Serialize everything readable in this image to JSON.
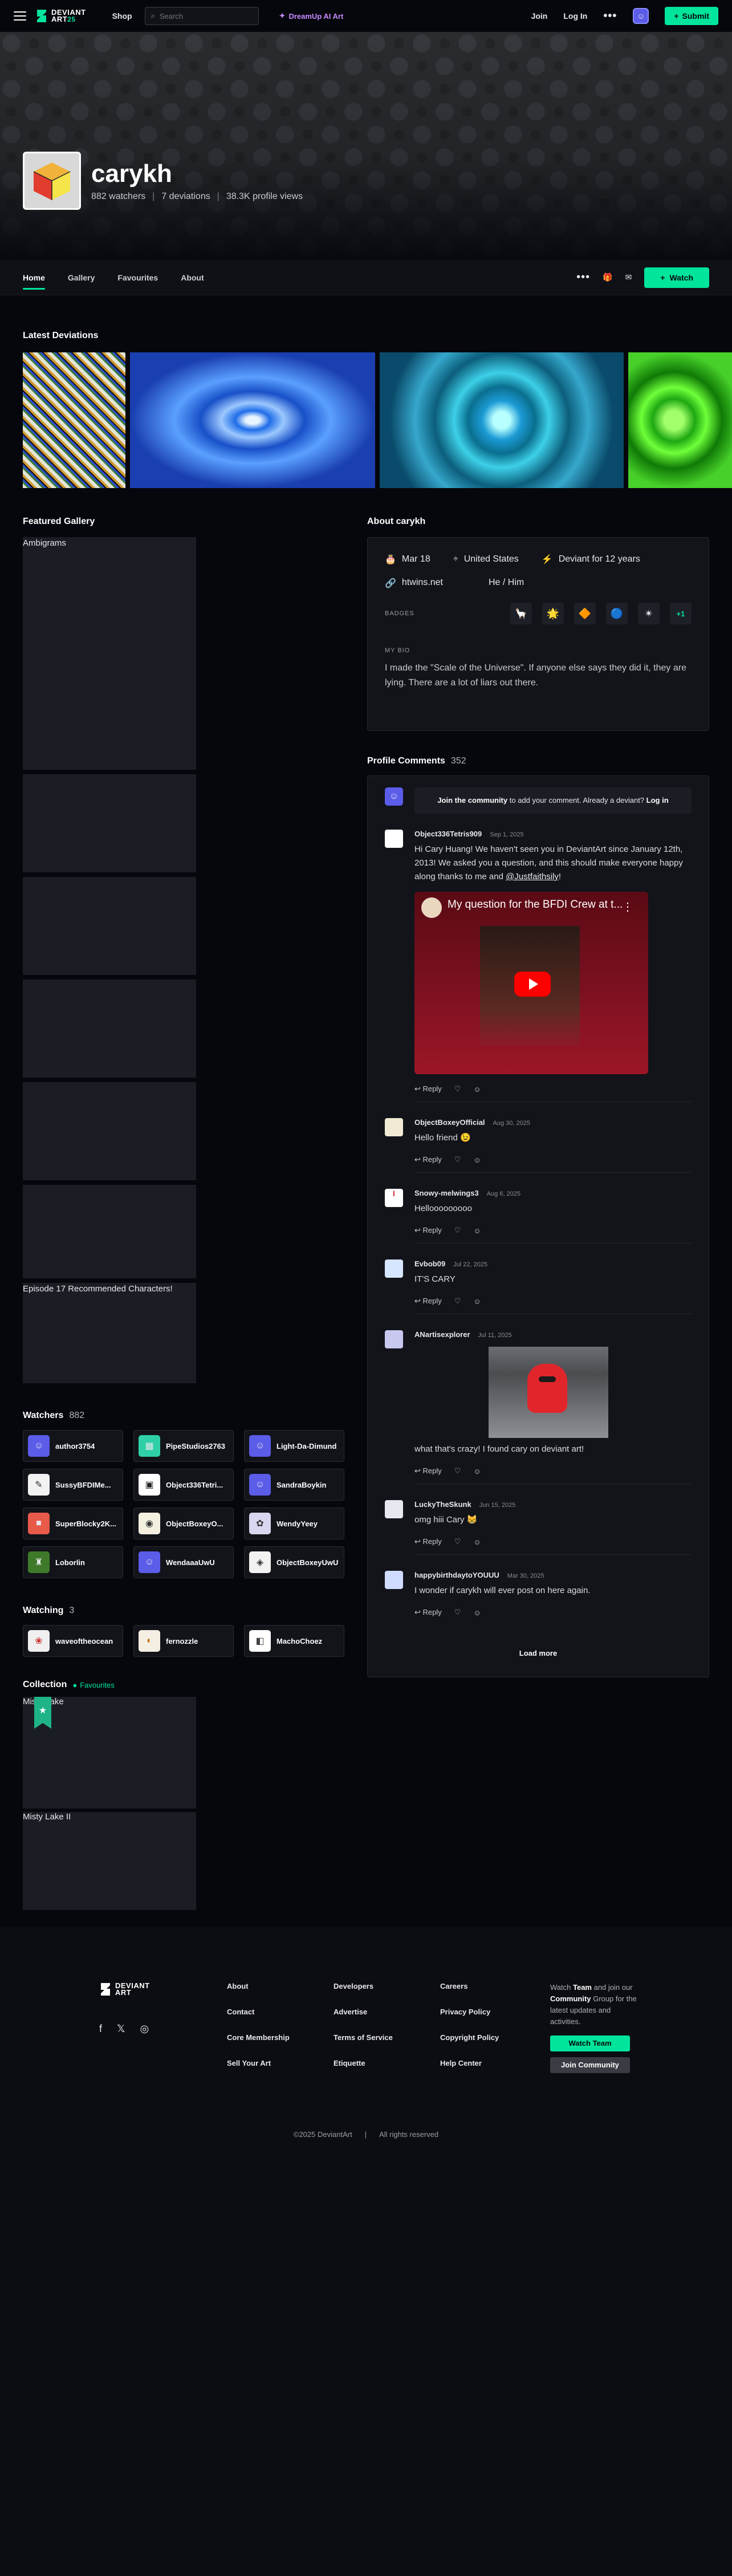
{
  "topbar": {
    "logo_line1": "DEVIANT",
    "logo_line2": "ART",
    "logo_years": "25",
    "shop": "Shop",
    "search_placeholder": "Search",
    "dreamup": "DreamUp AI Art",
    "join": "Join",
    "login": "Log In",
    "more": "•••",
    "submit": "Submit"
  },
  "profile": {
    "username": "carykh",
    "watchers": "882 watchers",
    "deviations": "7 deviations",
    "views": "38.3K profile views"
  },
  "tabs": {
    "items": [
      "Home",
      "Gallery",
      "Favourites",
      "About"
    ],
    "watch": "Watch"
  },
  "latest": {
    "title": "Latest Deviations"
  },
  "featured": {
    "title": "Featured Gallery",
    "items": [
      "Ambigrams",
      "",
      "",
      "",
      "",
      "",
      "Episode 17 Recommended Characters!"
    ]
  },
  "about": {
    "title": "About carykh",
    "birthday": "Mar 18",
    "country": "United States",
    "deviant_for": "Deviant for 12 years",
    "website": "htwins.net",
    "pronouns": "He / Him",
    "badges_label": "BADGES",
    "badges_more": "+1",
    "bio_label": "MY BIO",
    "bio": "I made the \"Scale of the Universe\".  If anyone else says they did it, they are lying.  There are a lot of liars out there."
  },
  "comments": {
    "title": "Profile Comments",
    "count": "352",
    "join_prefix": "Join the community",
    "join_middle": " to add your comment. Already a deviant? ",
    "join_login": "Log in",
    "reply": "Reply",
    "items": [
      {
        "name": "Object336Tetris909",
        "date": "Sep 1, 2025",
        "text": "Hi Cary Huang! We haven't seen you in DeviantArt since January 12th, 2013! We asked you a question, and this should make everyone happy along thanks to me and",
        "link": "@Justfaithsily",
        "tail": "!"
      },
      {
        "name": "ObjectBoxeyOfficial",
        "date": "Aug 30, 2025",
        "text": "Hello friend 😉"
      },
      {
        "name": "Snowy-melwings3",
        "date": "Aug 6, 2025",
        "text": "Hellooooooooo"
      },
      {
        "name": "Evbob09",
        "date": "Jul 22, 2025",
        "text": "IT'S CARY"
      },
      {
        "name": "ANartisexplorer",
        "date": "Jul 11, 2025",
        "text": "what that's crazy! I found cary on deviant art!"
      },
      {
        "name": "LuckyTheSkunk",
        "date": "Jun 15, 2025",
        "text": "omg hiii Cary 😸"
      },
      {
        "name": "happybirthdaytoYOUUU",
        "date": "Mar 30, 2025",
        "text": "I wonder if carykh will ever post on here again."
      }
    ],
    "video_title": "My question for the BFDI Crew at t...",
    "load_more": "Load more"
  },
  "watchers": {
    "title": "Watchers",
    "count": "882",
    "users": [
      "author3754",
      "PipeStudios2763",
      "Light-Da-Dimund",
      "SussyBFDIMe...",
      "Object336Tetri...",
      "SandraBoykin",
      "SuperBlocky2K...",
      "ObjectBoxeyO...",
      "WendyYeey",
      "Loborlin",
      "WendaaaUwU",
      "ObjectBoxeyUwU"
    ]
  },
  "watching": {
    "title": "Watching",
    "count": "3",
    "users": [
      "waveoftheocean",
      "fernozzle",
      "MachoChoez"
    ]
  },
  "collection": {
    "title": "Collection",
    "fav_label": "Favourites",
    "items": [
      "Misty Lake",
      "Misty Lake II"
    ]
  },
  "footer": {
    "col1": [
      "About",
      "Contact",
      "Core Membership",
      "Sell Your Art"
    ],
    "col2": [
      "Developers",
      "Advertise",
      "Terms of Service",
      "Etiquette"
    ],
    "col3": [
      "Careers",
      "Privacy Policy",
      "Copyright Policy",
      "Help Center"
    ],
    "team_watch": "Watch ",
    "team_name": "Team",
    "team_mid": " and join our ",
    "team_comm": "Community",
    "team_tail": " Group for the latest updates and activities.",
    "watch_team": "Watch Team",
    "join_community": "Join Community",
    "copyright": "©2025 DeviantArt",
    "rights": "All rights reserved"
  },
  "colors": {
    "accent": "#00e59b",
    "bg": "#06070d",
    "card": "#12141a"
  }
}
